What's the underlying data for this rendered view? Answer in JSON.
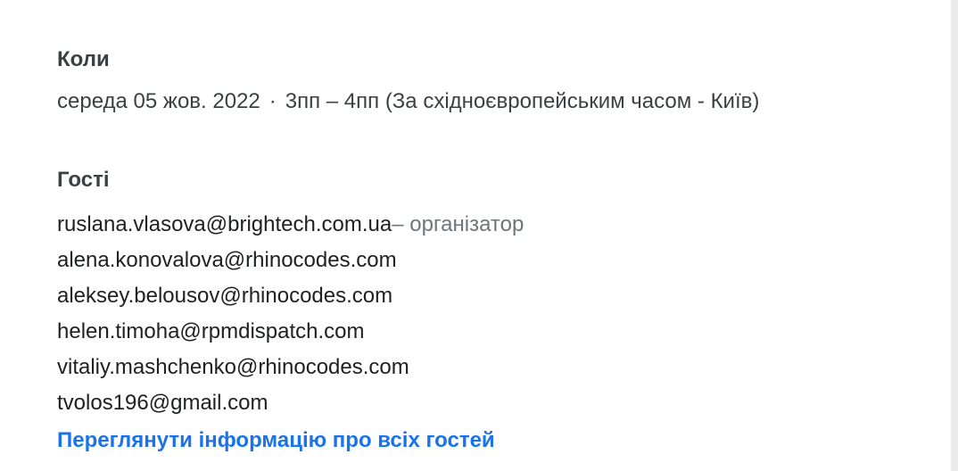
{
  "when": {
    "title": "Коли",
    "date": "середа 05 жов. 2022",
    "separator": "·",
    "time": "3пп – 4пп (За східноєвропейським часом - Київ)"
  },
  "guests": {
    "title": "Гості",
    "list": [
      {
        "email": "ruslana.vlasova@brightech.com.ua",
        "role": "– організатор"
      },
      {
        "email": "alena.konovalova@rhinocodes.com"
      },
      {
        "email": "aleksey.belousov@rhinocodes.com"
      },
      {
        "email": "helen.timoha@rpmdispatch.com"
      },
      {
        "email": "vitaliy.mashchenko@rhinocodes.com"
      },
      {
        "email": "tvolos196@gmail.com"
      }
    ],
    "view_all_label": "Переглянути інформацію про всіх гостей"
  },
  "colors": {
    "link": "#1a73e8",
    "text": "#202124",
    "secondary_text": "#70757a",
    "heading": "#3c4043"
  }
}
